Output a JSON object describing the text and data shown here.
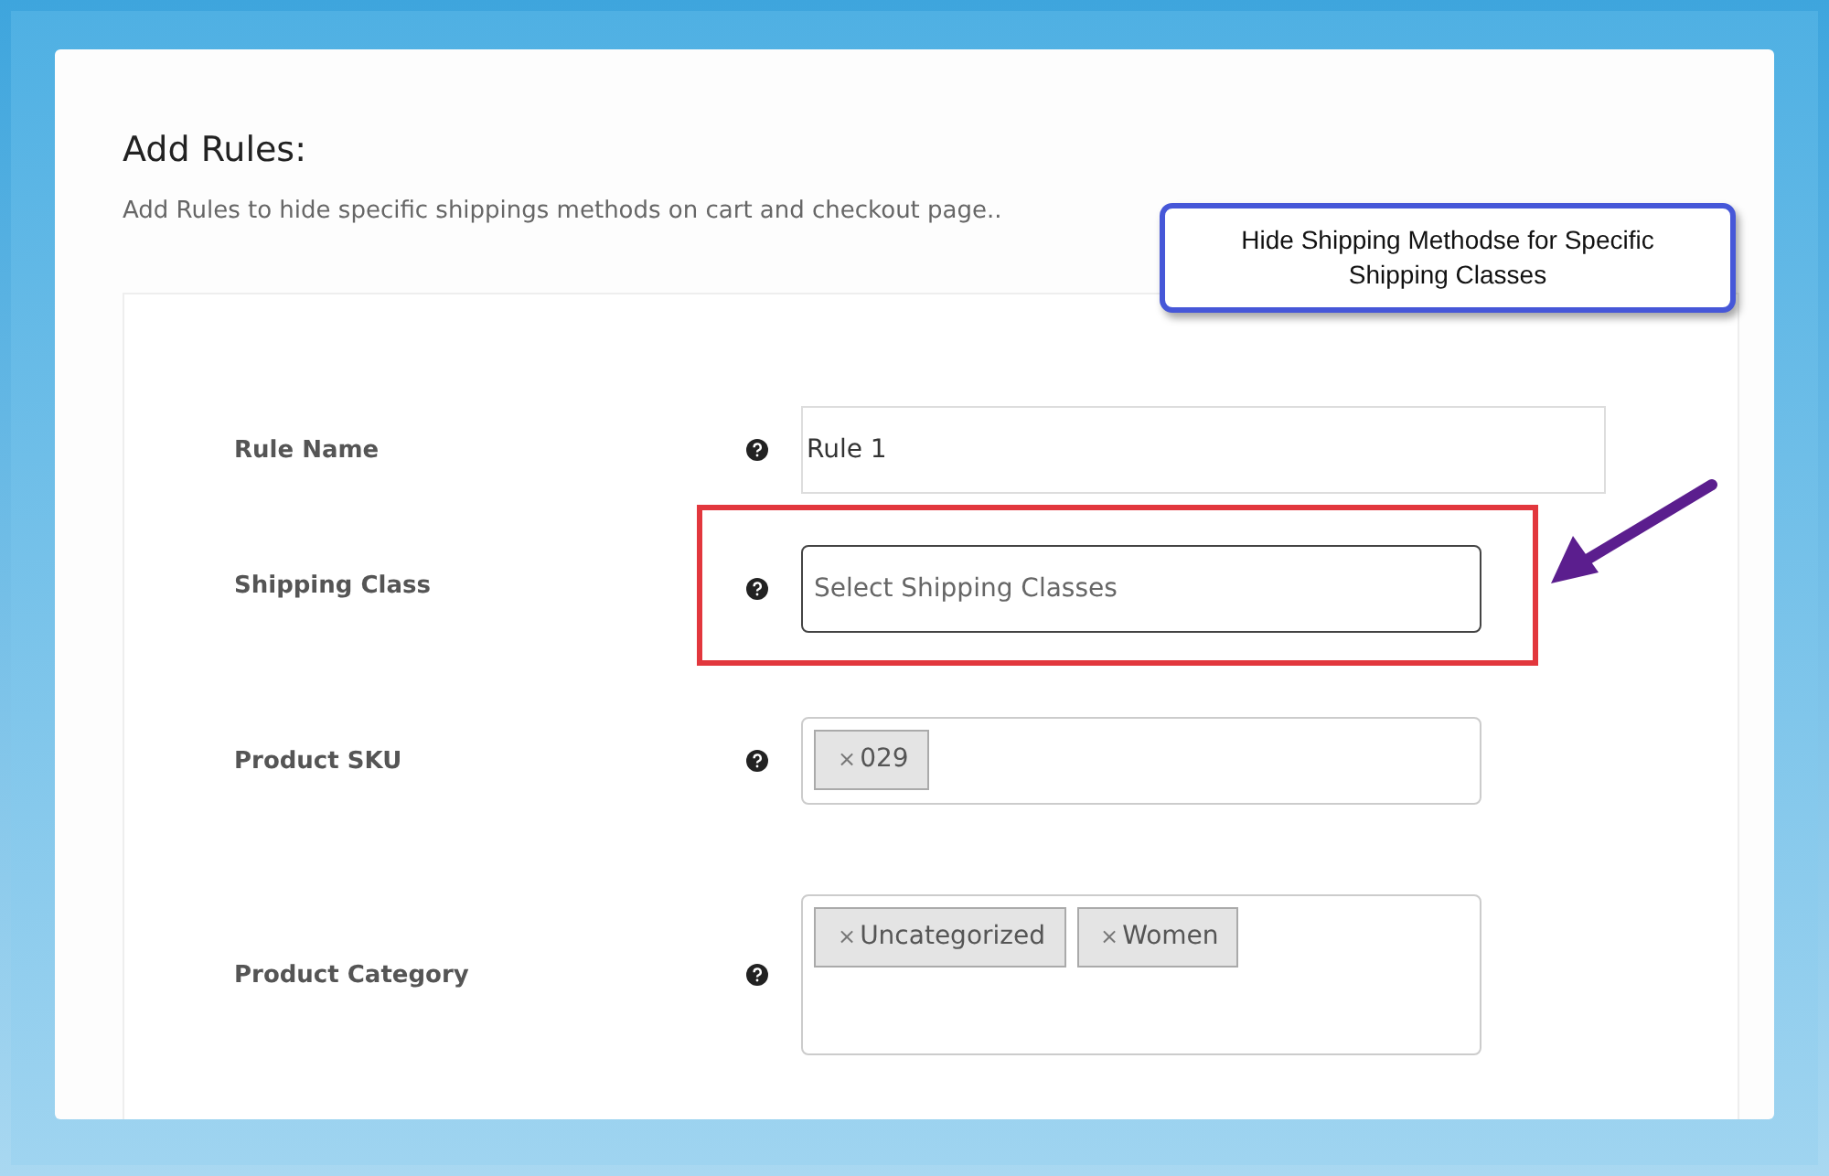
{
  "heading": "Add Rules:",
  "description": "Add Rules to hide specific shippings methods on cart and checkout page..",
  "callout": {
    "text": "Hide Shipping Methodse for Specific Shipping Classes"
  },
  "fields": [
    {
      "label": "Rule Name",
      "kind": "text",
      "value": "Rule 1",
      "highlighted": false
    },
    {
      "label": "Shipping Class",
      "kind": "select",
      "placeholder": "Select Shipping Classes",
      "highlighted": true
    },
    {
      "label": "Product SKU",
      "kind": "tags",
      "tags": [
        {
          "remove": "×",
          "text": "029"
        }
      ],
      "highlighted": false
    },
    {
      "label": "Product Category",
      "kind": "tags",
      "tags": [
        {
          "remove": "×",
          "text": "Uncategorized"
        },
        {
          "remove": "×",
          "text": "Women"
        }
      ],
      "highlighted": false
    }
  ]
}
